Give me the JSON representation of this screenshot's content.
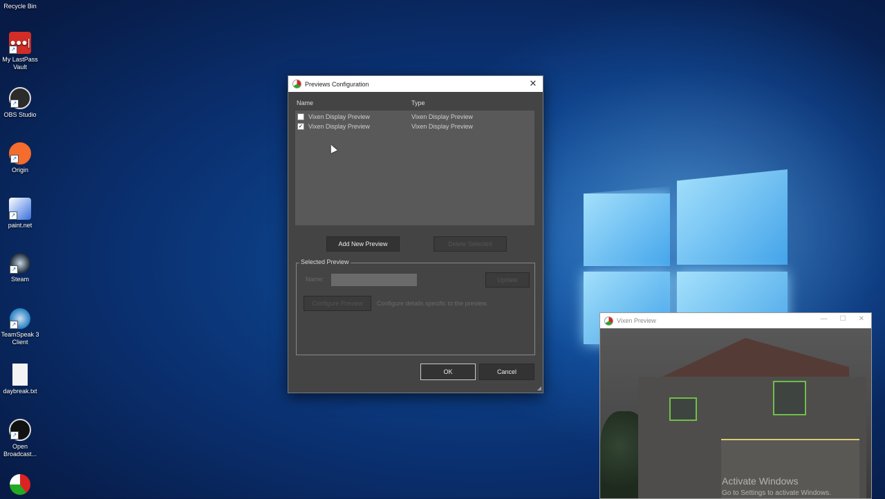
{
  "desktop": {
    "icons": [
      {
        "label": "Recycle Bin",
        "icon": "recycle-bin-icon"
      },
      {
        "label": "My LastPass Vault",
        "icon": "lastpass-icon",
        "color": "#d32d27"
      },
      {
        "label": "OBS Studio",
        "icon": "obs-icon",
        "color": "#2b2b2b"
      },
      {
        "label": "Origin",
        "icon": "origin-icon",
        "color": "#f56c2d"
      },
      {
        "label": "paint.net",
        "icon": "paintnet-icon",
        "color": "#3a6fd8"
      },
      {
        "label": "Steam",
        "icon": "steam-icon",
        "color": "#1b2838"
      },
      {
        "label": "TeamSpeak 3 Client",
        "icon": "teamspeak-icon",
        "color": "#2580c3"
      },
      {
        "label": "daybreak.txt",
        "icon": "text-file-icon",
        "color": "#f4f4f4"
      },
      {
        "label": "Open Broadcast...",
        "icon": "obs-icon",
        "color": "#2b2b2b"
      },
      {
        "label": "",
        "icon": "vixen-icon",
        "color": "#d22"
      }
    ]
  },
  "dialog": {
    "title": "Previews Configuration",
    "columns": {
      "name": "Name",
      "type": "Type"
    },
    "rows": [
      {
        "checked": false,
        "name": "Vixen Display Preview",
        "type": "Vixen Display Preview"
      },
      {
        "checked": true,
        "name": "Vixen Display Preview",
        "type": "Vixen Display Preview"
      }
    ],
    "add_button": "Add New Preview",
    "delete_button": "Delete Selected",
    "group_title": "Selected Preview",
    "name_label": "Name:",
    "name_value": "",
    "update_button": "Update",
    "configure_button": "Configure Preview",
    "configure_hint": "Configure details specific to the preview.",
    "ok_button": "OK",
    "cancel_button": "Cancel"
  },
  "vixen_window": {
    "title": "Vixen Preview",
    "minimize": "—",
    "maximize": "☐",
    "close": "✕"
  },
  "watermark": {
    "line1": "Activate Windows",
    "line2": "Go to Settings to activate Windows."
  },
  "colors": {
    "dialog_bg": "#444444",
    "list_bg": "#595959",
    "accent_green": "#6fbf4a"
  }
}
